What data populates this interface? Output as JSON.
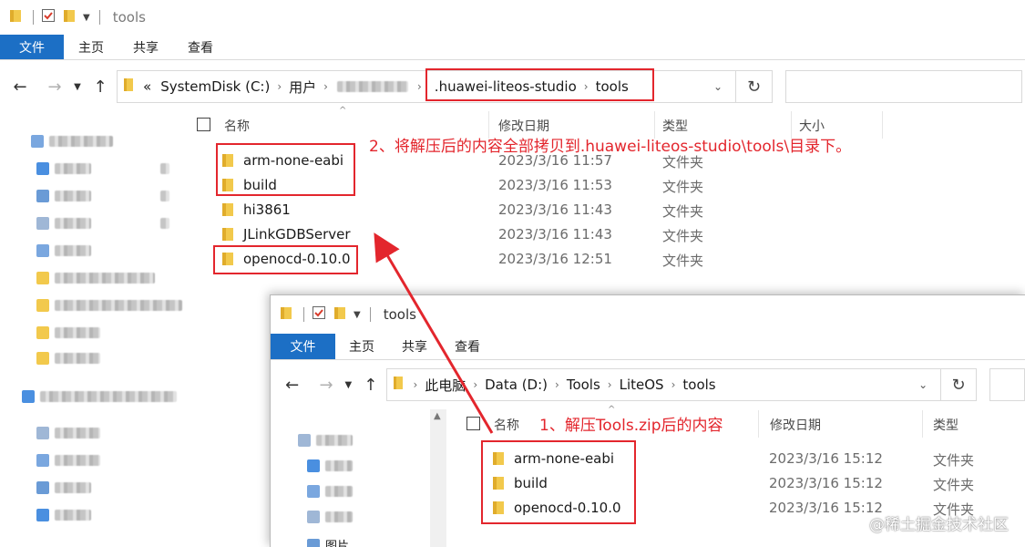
{
  "window_back": {
    "title": "tools",
    "ribbon_tabs": [
      "文件",
      "主页",
      "共享",
      "查看"
    ],
    "breadcrumb": {
      "prefix": "«",
      "items": [
        "SystemDisk (C:)",
        "用户",
        ".huawei-liteos-studio",
        "tools"
      ]
    },
    "columns": {
      "name": "名称",
      "modified": "修改日期",
      "type": "类型",
      "size": "大小"
    },
    "files": [
      {
        "name": "arm-none-eabi",
        "modified": "2023/3/16 11:57",
        "type": "文件夹"
      },
      {
        "name": "build",
        "modified": "2023/3/16 11:53",
        "type": "文件夹"
      },
      {
        "name": "hi3861",
        "modified": "2023/3/16 11:43",
        "type": "文件夹"
      },
      {
        "name": "JLinkGDBServer",
        "modified": "2023/3/16 11:43",
        "type": "文件夹"
      },
      {
        "name": "openocd-0.10.0",
        "modified": "2023/3/16 12:51",
        "type": "文件夹"
      }
    ]
  },
  "window_front": {
    "title": "tools",
    "ribbon_tabs": [
      "文件",
      "主页",
      "共享",
      "查看"
    ],
    "breadcrumb": {
      "items": [
        "此电脑",
        "Data (D:)",
        "Tools",
        "LiteOS",
        "tools"
      ]
    },
    "columns": {
      "name": "名称",
      "modified": "修改日期",
      "type": "类型"
    },
    "files": [
      {
        "name": "arm-none-eabi",
        "modified": "2023/3/16 15:12",
        "type": "文件夹"
      },
      {
        "name": "build",
        "modified": "2023/3/16 15:12",
        "type": "文件夹"
      },
      {
        "name": "openocd-0.10.0",
        "modified": "2023/3/16 15:12",
        "type": "文件夹"
      }
    ],
    "sidebar_partial_label": "图片"
  },
  "annotations": {
    "step1": "1、解压Tools.zip后的内容",
    "step2": "2、将解压后的内容全部拷贝到.huawei-liteos-studio\\tools\\目录下。",
    "color": "#e3262d"
  },
  "watermark": "@稀土掘金技术社区",
  "colors": {
    "accent": "#1c6fc5",
    "folder": "#f4c542",
    "annotation": "#e3262d"
  }
}
